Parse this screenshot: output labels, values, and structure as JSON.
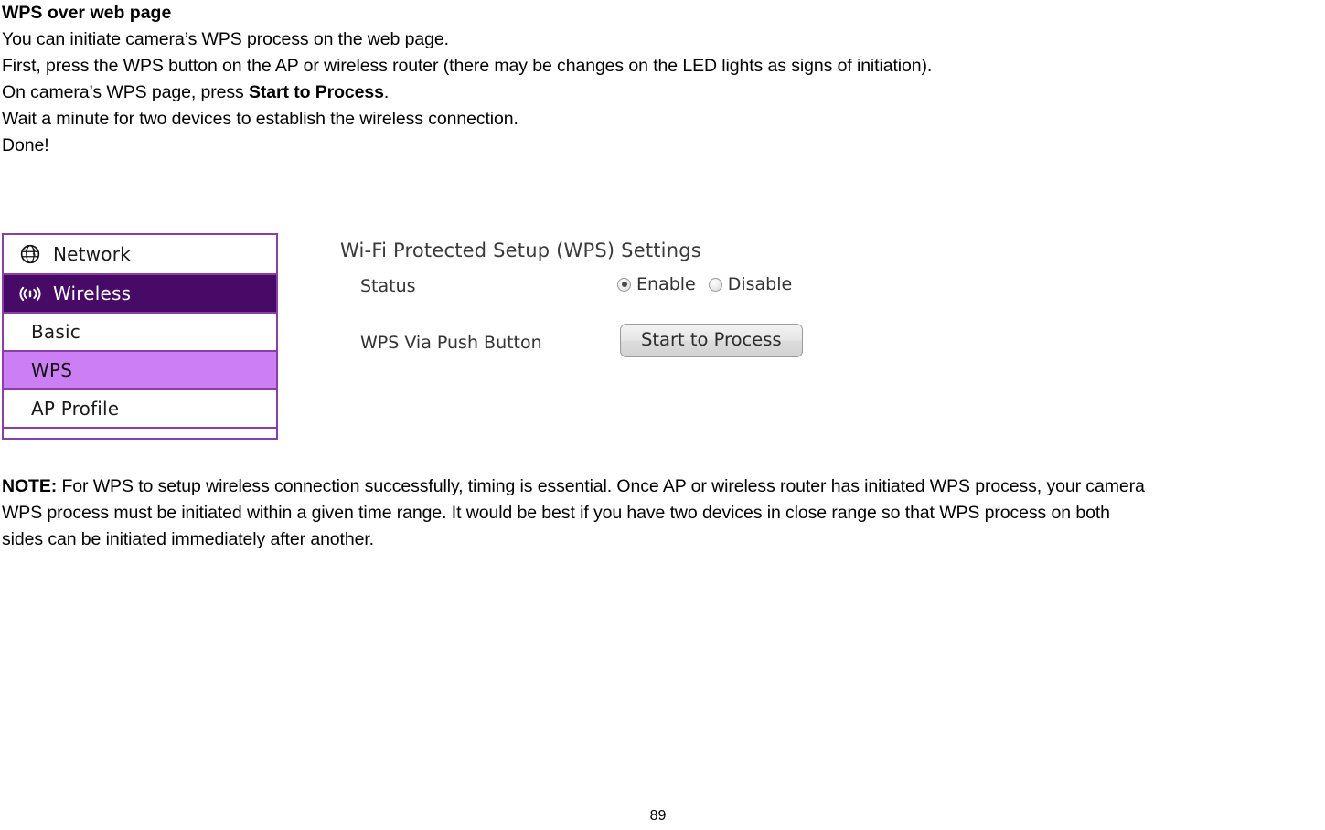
{
  "document": {
    "heading": "WPS over web page",
    "paragraphs": [
      {
        "text": "You can initiate camera’s WPS process on the web page."
      },
      {
        "text": "First, press the WPS button on the AP or wireless router (there may be changes on the LED lights as signs of initiation)."
      },
      {
        "pre": "On camera’s WPS page, press ",
        "bold": "Start to Process",
        "post": "."
      },
      {
        "text": "Wait a minute for two devices to establish the wireless connection."
      },
      {
        "text": "Done!"
      }
    ],
    "note": {
      "label": "NOTE:",
      "lines": [
        " For WPS to setup wireless connection successfully, timing is essential. Once AP or wireless router has initiated WPS process, your camera",
        "WPS process must be initiated within a given time range. It would be best if you have two devices in close range so that WPS process on both",
        "sides can be initiated immediately after another."
      ]
    },
    "page_number": "89"
  },
  "screenshot": {
    "sidebar": {
      "items": [
        {
          "label": "Network",
          "icon": "globe-icon",
          "level": 1,
          "state": "normal"
        },
        {
          "label": "Wireless",
          "icon": "wireless-icon",
          "level": 1,
          "state": "selected-dark"
        },
        {
          "label": "Basic",
          "icon": "",
          "level": 2,
          "state": "normal"
        },
        {
          "label": "WPS",
          "icon": "",
          "level": 2,
          "state": "selected-light"
        },
        {
          "label": "AP Profile",
          "icon": "",
          "level": 2,
          "state": "normal"
        }
      ],
      "colors": {
        "border": "#8A3FA8",
        "selected_dark_bg": "#470A66",
        "selected_light_bg": "#CC7FF5"
      }
    },
    "panel": {
      "title": "Wi-Fi Protected Setup (WPS) Settings",
      "status_label": "Status",
      "status_options": [
        {
          "label": "Enable",
          "selected": true
        },
        {
          "label": "Disable",
          "selected": false
        }
      ],
      "push_button_label": "WPS Via Push Button",
      "push_button_text": "Start to Process"
    }
  }
}
